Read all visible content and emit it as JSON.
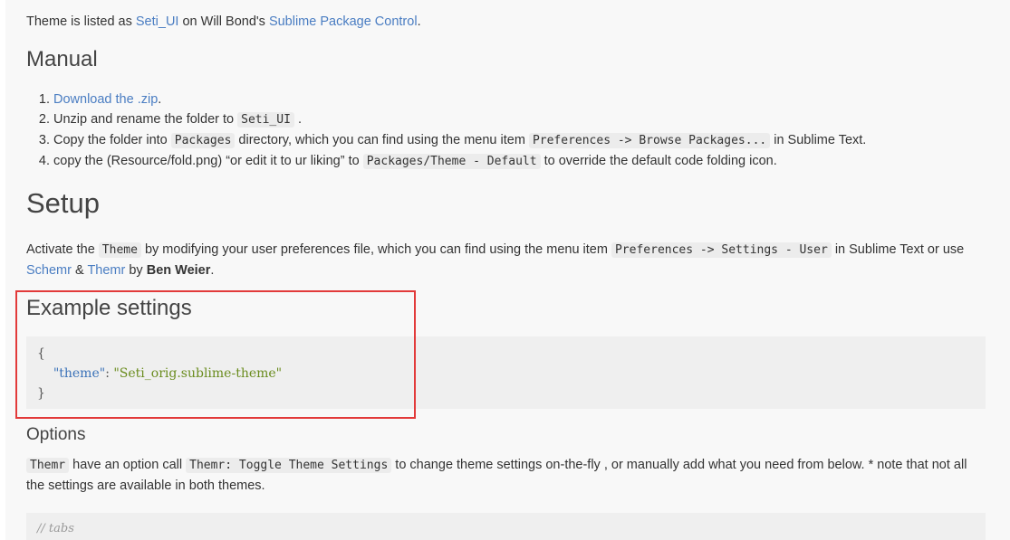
{
  "intro": {
    "text_before": "Theme is listed as ",
    "seti_link": "Seti_UI",
    "text_middle": " on Will Bond's ",
    "package_link": "Sublime Package Control",
    "text_after": "."
  },
  "manual": {
    "heading": "Manual",
    "steps": [
      {
        "link": "Download the .zip",
        "after": "."
      },
      {
        "before": "Unzip and rename the folder to ",
        "code": "Seti_UI",
        "after": " ."
      },
      {
        "before": "Copy the folder into ",
        "code1": "Packages",
        "middle": " directory, which you can find using the menu item ",
        "code2": "Preferences -> Browse Packages...",
        "after": " in Sublime Text."
      },
      {
        "before": "copy the (Resource/fold.png) “or edit it to ur liking” to ",
        "code": "Packages/Theme - Default",
        "after": " to override the default code folding icon."
      }
    ]
  },
  "setup": {
    "heading": "Setup",
    "p_before": "Activate the ",
    "code1": "Theme",
    "p_middle": " by modifying your user preferences file, which you can find using the menu item ",
    "code2": "Preferences -> Settings - User",
    "p_after": " in Sublime Text or use",
    "schemr_link": "Schemr",
    "amp": " & ",
    "themr_link": "Themr",
    "by": " by ",
    "author": "Ben Weier",
    "end": "."
  },
  "example": {
    "heading": "Example settings",
    "open_brace": "{",
    "key": "\"theme\"",
    "colon": ": ",
    "value": "\"Seti_orig.sublime-theme\"",
    "close_brace": "}"
  },
  "options": {
    "heading": "Options",
    "code1": "Themr",
    "text1": " have an option call ",
    "code2": "Themr: Toggle Theme Settings",
    "text2": " to change theme settings on-the-fly , or manually add what you need from below. * note that not all",
    "text3": "the settings are available in both themes.",
    "tabs_comment": "// tabs"
  },
  "colors": {
    "link": "#4a7dc2",
    "highlight_border": "#e23a3a",
    "code_bg": "#efefef"
  }
}
